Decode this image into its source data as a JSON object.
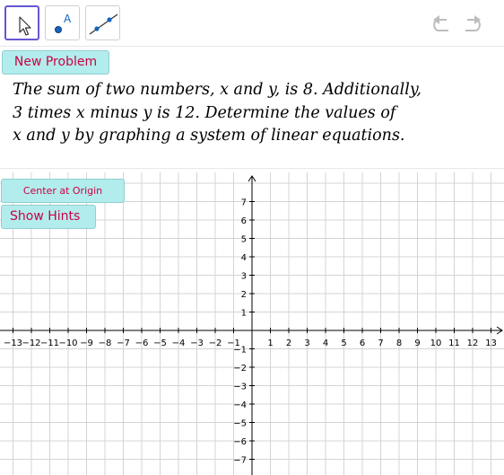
{
  "toolbar": {
    "tools": [
      {
        "name": "move",
        "icon": "arrow-cursor-icon",
        "active": true
      },
      {
        "name": "point",
        "icon": "point-icon",
        "point_label": "A"
      },
      {
        "name": "line",
        "icon": "line-icon"
      }
    ],
    "undo_icon": "undo-icon",
    "redo_icon": "redo-icon"
  },
  "buttons": {
    "new_problem": "New Problem",
    "center_at_origin": "Center at Origin",
    "show_hints": "Show Hints"
  },
  "problem": {
    "line1": "The sum of two numbers,  x and y, is 8.  Additionally,",
    "line2": "3 times x minus y is 12.  Determine the values of",
    "line3": "x and y by graphing a system of linear equations."
  },
  "graph": {
    "x_ticks": [
      -13,
      -12,
      -11,
      -10,
      -9,
      -8,
      -7,
      -6,
      -5,
      -4,
      -3,
      -2,
      -1,
      1,
      2,
      3,
      4,
      5,
      6,
      7,
      8,
      9,
      10,
      11,
      12,
      13
    ],
    "y_ticks": [
      7,
      6,
      5,
      4,
      3,
      2,
      1,
      -1,
      -2,
      -3,
      -4,
      -5,
      -6,
      -7
    ],
    "x_range": [
      -13.8,
      13.8
    ],
    "y_range": [
      -7.6,
      8.2
    ],
    "grid": true
  },
  "colors": {
    "button_bg": "#b2ecec",
    "button_text": "#cc0044",
    "active_tool_border": "#6557d2",
    "point_color": "#1565c0",
    "point_label_color": "#1565c0",
    "grid": "#d4d4d4"
  }
}
